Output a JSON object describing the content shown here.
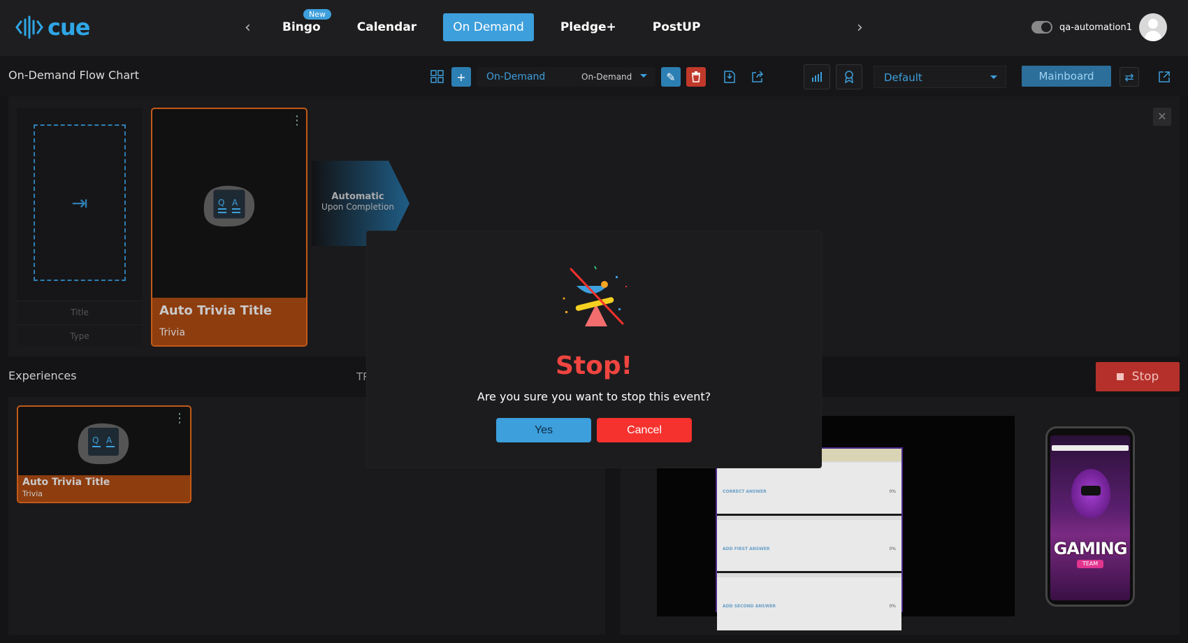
{
  "app": {
    "logo_text": "cue"
  },
  "nav": {
    "items": [
      {
        "label": "Bingo",
        "badge": "New"
      },
      {
        "label": "Calendar"
      },
      {
        "label": "On Demand"
      },
      {
        "label": "Pledge+"
      },
      {
        "label": "PostUP"
      }
    ],
    "prev_arrow": "‹",
    "next_arrow": "›"
  },
  "user": {
    "username": "qa-automation1"
  },
  "toolbar": {
    "page_title": "On-Demand Flow Chart",
    "ondemand_name": "On-Demand",
    "ondemand_type": "On-Demand",
    "layout_select": "Default",
    "mainboard_label": "Mainboard"
  },
  "flow": {
    "empty_slot": {
      "title_placeholder": "Title",
      "type_placeholder": "Type"
    },
    "card": {
      "title": "Auto Trivia Title",
      "type": "Trivia"
    },
    "transition": {
      "mode": "Automatic",
      "condition": "Upon Completion"
    }
  },
  "experiences": {
    "title": "Experiences",
    "tr_label": "TR",
    "stop_label": "Stop",
    "card": {
      "title": "Auto Trivia Title",
      "type": "Trivia"
    }
  },
  "preview": {
    "answers": [
      {
        "label": "CORRECT ANSWER",
        "percent": "0%"
      },
      {
        "label": "ADD FIRST ANSWER",
        "percent": "0%"
      },
      {
        "label": "ADD SECOND ANSWER",
        "percent": "0%"
      }
    ],
    "phone_logo": "GAMING",
    "phone_logo_sub": "TEAM"
  },
  "modal": {
    "title": "Stop!",
    "message": "Are you sure you want to stop this event?",
    "yes_label": "Yes",
    "cancel_label": "Cancel"
  },
  "colors": {
    "accent": "#3d9fdc",
    "danger": "#f5322e",
    "card_border": "#c45a18",
    "card_footer": "#8e3d0f"
  }
}
